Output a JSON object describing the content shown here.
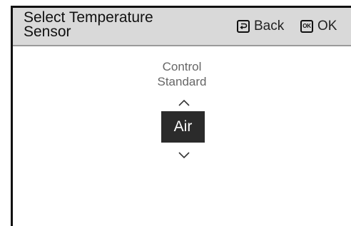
{
  "header": {
    "title_line1": "Select Temperature",
    "title_line2": "Sensor",
    "back_label": "Back",
    "ok_label": "OK",
    "ok_icon_text": "OK"
  },
  "picker": {
    "prev_option_line1": "Control",
    "prev_option_line2": "Standard",
    "selected_option": "Air"
  },
  "icons": {
    "back": "back-key-icon",
    "ok": "ok-key-icon",
    "up": "chevron-up-icon",
    "down": "chevron-down-icon"
  }
}
